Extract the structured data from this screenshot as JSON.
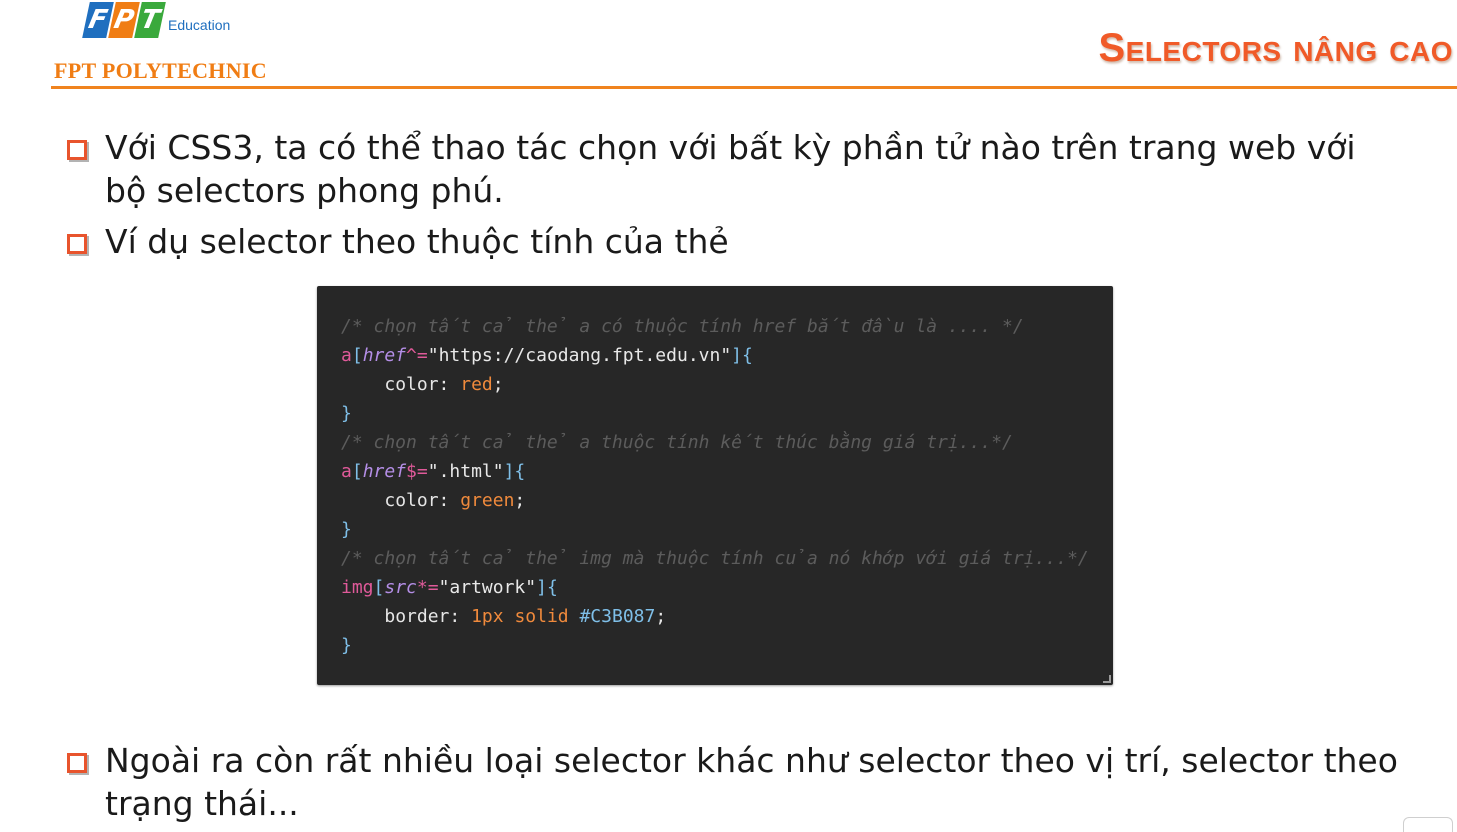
{
  "header": {
    "logo_letters": [
      "F",
      "P",
      "T"
    ],
    "logo_education": "Education",
    "brand": "FPT POLYTECHNIC",
    "title": "Selectors nâng cao",
    "colors": {
      "orange": "#f07d14",
      "title": "#f05a28",
      "blue": "#1f6fbf",
      "green": "#3aa93c"
    }
  },
  "bullets": [
    {
      "text": "Với CSS3, ta có thể thao tác chọn với bất kỳ phần tử nào trên trang web với bộ selectors phong phú."
    },
    {
      "text": "Ví dụ selector theo thuộc tính của thẻ"
    },
    {
      "text": "Ngoài ra còn rất nhiều loại selector khác như selector theo vị trí, selector theo trạng thái..."
    }
  ],
  "code": {
    "comment1": "/* chọn tất cả thẻ a có thuộc tính href bắt đầu là .... */",
    "sel1": "a",
    "attr1": "href",
    "op1": "^=",
    "val1": "\"https://caodang.fpt.edu.vn\"",
    "prop1": "color",
    "value1": "red",
    "comment2": "/* chọn tất cả thẻ a thuộc tính kết thúc bằng giá trị...*/",
    "sel2": "a",
    "attr2": "href",
    "op2": "$=",
    "val2": "\".html\"",
    "prop2": "color",
    "value2": "green",
    "comment3": "/* chọn tất cả thẻ img mà thuộc tính của nó khớp với giá trị...*/",
    "sel3": "img",
    "attr3": "src",
    "op3": "*=",
    "val3": "\"artwork\"",
    "prop3": "border",
    "value3a": "1px",
    "value3b": "solid",
    "value3c": "#C3B087"
  }
}
